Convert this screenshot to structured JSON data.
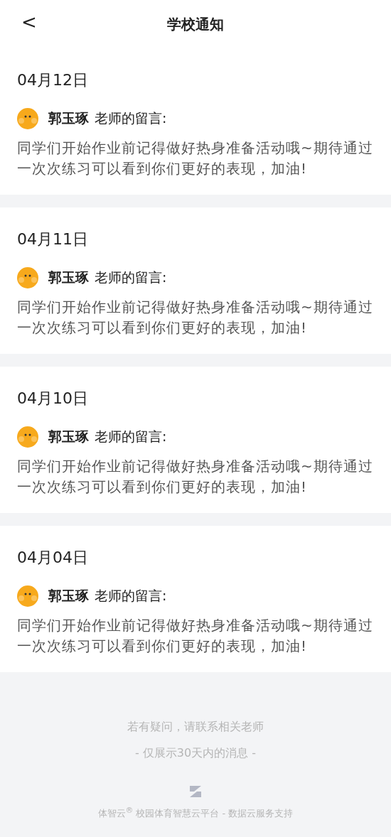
{
  "header": {
    "back": "<",
    "title": "学校通知"
  },
  "notices": [
    {
      "date": "04月12日",
      "teacher": "郭玉琢",
      "label": "老师的留言:",
      "message": "同学们开始作业前记得做好热身准备活动哦~期待通过一次次练习可以看到你们更好的表现，加油!"
    },
    {
      "date": "04月11日",
      "teacher": "郭玉琢",
      "label": "老师的留言:",
      "message": "同学们开始作业前记得做好热身准备活动哦~期待通过一次次练习可以看到你们更好的表现，加油!"
    },
    {
      "date": "04月10日",
      "teacher": "郭玉琢",
      "label": "老师的留言:",
      "message": "同学们开始作业前记得做好热身准备活动哦~期待通过一次次练习可以看到你们更好的表现，加油!"
    },
    {
      "date": "04月04日",
      "teacher": "郭玉琢",
      "label": "老师的留言:",
      "message": "同学们开始作业前记得做好热身准备活动哦~期待通过一次次练习可以看到你们更好的表现，加油!"
    }
  ],
  "footer": {
    "hint": "若有疑问，请联系相关老师",
    "range": "- 仅展示30天内的消息 -",
    "credit": "体智云$^{®}$ 校园体育智慧云平台 - 数据云服务支持"
  }
}
